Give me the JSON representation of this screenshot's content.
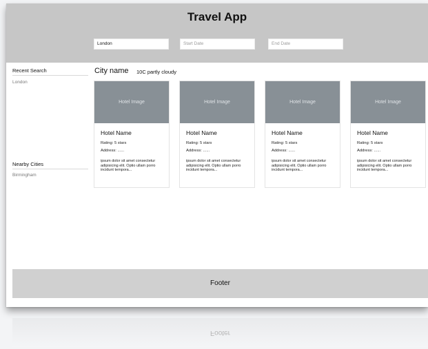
{
  "app": {
    "title": "Travel App"
  },
  "search": {
    "city_value": "London",
    "start_placeholder": "Start Date",
    "end_placeholder": "End Date"
  },
  "sidebar": {
    "recent_heading": "Recent Search",
    "recent_items": [
      "London"
    ],
    "nearby_heading": "Nearby Cities",
    "nearby_items": [
      "Birmingham"
    ]
  },
  "main": {
    "city_name": "City name",
    "weather": "10C  partly cloudy",
    "hotels": [
      {
        "image_label": "Hotel Image",
        "name": "Hotel Name",
        "rating": "Rating: 5 stars",
        "address": "Address: ......",
        "description": "ipsum dolor sit amet consectetur adipisicing elit. Optio ullam porro incidunt tempora..."
      },
      {
        "image_label": "Hotel Image",
        "name": "Hotel Name",
        "rating": "Rating: 5 stars",
        "address": "Address: ......",
        "description": "ipsum dolor sit amet consectetur adipisicing elit. Optio ullam porro incidunt tempora..."
      },
      {
        "image_label": "Hotel Image",
        "name": "Hotel Name",
        "rating": "Rating: 5 stars",
        "address": "Address: ......",
        "description": "ipsum dolor sit amet consectetur adipisicing elit. Optio ullam porro incidunt tempora..."
      },
      {
        "image_label": "Hotel Image",
        "name": "Hotel Name",
        "rating": "Rating: 5 stars",
        "address": "Address: ......",
        "description": "ipsum dolor sit amet consectetur adipisicing elit. Optio ullam porro incidunt tempora..."
      }
    ]
  },
  "footer": {
    "label": "Footer"
  },
  "colors": {
    "header_bg": "#c6c6c6",
    "image_placeholder": "#889096",
    "footer_bg": "#d0d0d0"
  }
}
